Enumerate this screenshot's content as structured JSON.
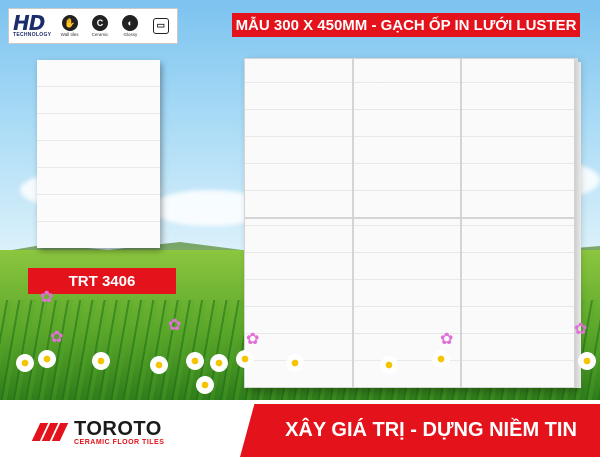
{
  "brand": {
    "logo_text": "HD",
    "logo_subtitle": "TECHNOLOGY",
    "features": [
      {
        "icon": "hand-icon",
        "glyph": "✋",
        "label": "Wall tiles"
      },
      {
        "icon": "ceramic-c-icon",
        "glyph": "C",
        "label": "Ceramic"
      },
      {
        "icon": "glossy-icon",
        "glyph": "◐",
        "label": "Glossy"
      },
      {
        "icon": "tile-size-icon",
        "glyph": "▭",
        "label": ""
      }
    ]
  },
  "title_banner": "MẪU  300 X 450MM  -    GẠCH ỐP IN LƯỚI LUSTER",
  "product_code": "TRT 3406",
  "footer": {
    "logo_name": "TOROTO",
    "logo_subtitle": "CERAMIC FLOOR TILES",
    "slogan": "XÂY GIÁ TRỊ - DỰNG NIỀM TIN"
  },
  "colors": {
    "accent_red": "#e3121b",
    "brand_navy": "#1a2c6b",
    "tile_white": "#fafafa"
  }
}
